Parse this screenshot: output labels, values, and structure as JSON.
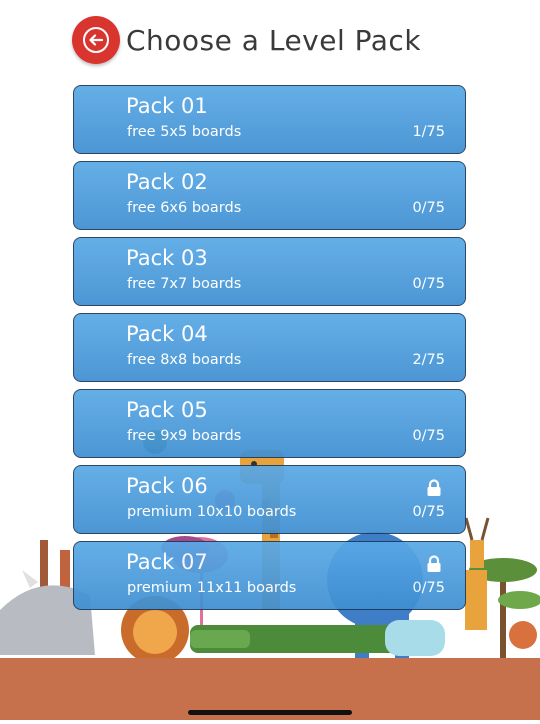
{
  "header": {
    "title": "Choose a Level Pack",
    "back_icon": "back-arrow-icon",
    "accent_color": "#d9352f"
  },
  "packs": [
    {
      "name": "Pack 01",
      "description": "free 5x5 boards",
      "progress": "1/75",
      "locked": false
    },
    {
      "name": "Pack 02",
      "description": "free 6x6 boards",
      "progress": "0/75",
      "locked": false
    },
    {
      "name": "Pack 03",
      "description": "free 7x7 boards",
      "progress": "0/75",
      "locked": false
    },
    {
      "name": "Pack 04",
      "description": "free 8x8 boards",
      "progress": "2/75",
      "locked": false
    },
    {
      "name": "Pack 05",
      "description": "free 9x9 boards",
      "progress": "0/75",
      "locked": false
    },
    {
      "name": "Pack 06",
      "description": "premium 10x10 boards",
      "progress": "0/75",
      "locked": true
    },
    {
      "name": "Pack 07",
      "description": "premium 11x11 boards",
      "progress": "0/75",
      "locked": true
    }
  ],
  "colors": {
    "pack_button": "#4a9be0",
    "pack_border": "#1c3b5c",
    "ground": "#c7714c"
  }
}
